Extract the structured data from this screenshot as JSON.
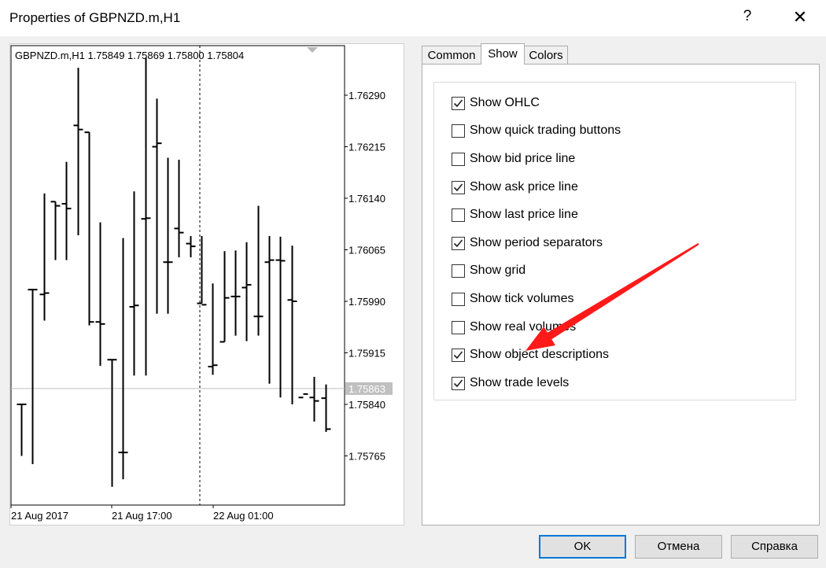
{
  "window": {
    "title": "Properties of GBPNZD.m,H1",
    "help_label": "?",
    "close_label": "✕"
  },
  "chart": {
    "symbol_label": "GBPNZD.m,H1",
    "ohlc_values": "1.75849 1.75869 1.75800 1.75804",
    "price_labels": [
      "1.76290",
      "1.76215",
      "1.76140",
      "1.76065",
      "1.75990",
      "1.75915",
      "1.75840",
      "1.75765"
    ],
    "current_price": "1.75863",
    "time_labels": [
      "21 Aug 2017",
      "21 Aug 17:00",
      "22 Aug 01:00"
    ],
    "bar_color": "#000000",
    "bid_line_color": "#c0c0c0",
    "current_price_bg": "#c0c0c0",
    "bars": [
      {
        "o": 1.7584,
        "h": 1.7584,
        "l": 1.75765,
        "c": 1.7584
      },
      {
        "o": 1.76007,
        "h": 1.76007,
        "l": 1.75753,
        "c": 1.76007
      },
      {
        "o": 1.76,
        "h": 1.76147,
        "l": 1.75962,
        "c": 1.76002
      },
      {
        "o": 1.76135,
        "h": 1.76135,
        "l": 1.7605,
        "c": 1.76129
      },
      {
        "o": 1.76132,
        "h": 1.76193,
        "l": 1.7605,
        "c": 1.76125
      },
      {
        "o": 1.76246,
        "h": 1.7633,
        "l": 1.76086,
        "c": 1.7624
      },
      {
        "o": 1.76236,
        "h": 1.76236,
        "l": 1.75955,
        "c": 1.7596
      },
      {
        "o": 1.7596,
        "h": 1.76105,
        "l": 1.75896,
        "c": 1.75957
      },
      {
        "o": 1.75905,
        "h": 1.75905,
        "l": 1.7572,
        "c": 1.75905
      },
      {
        "o": 1.7577,
        "h": 1.76082,
        "l": 1.75731,
        "c": 1.7577
      },
      {
        "o": 1.75982,
        "h": 1.7615,
        "l": 1.75882,
        "c": 1.75984
      },
      {
        "o": 1.7611,
        "h": 1.76345,
        "l": 1.75882,
        "c": 1.76111
      },
      {
        "o": 1.76215,
        "h": 1.76285,
        "l": 1.75972,
        "c": 1.7622
      },
      {
        "o": 1.76047,
        "h": 1.76199,
        "l": 1.75972,
        "c": 1.76047
      },
      {
        "o": 1.76096,
        "h": 1.76196,
        "l": 1.76054,
        "c": 1.7609
      },
      {
        "o": 1.76074,
        "h": 1.76085,
        "l": 1.76054,
        "c": 1.7607
      },
      {
        "o": 1.75987,
        "h": 1.76085,
        "l": 1.75987,
        "c": 1.75985
      },
      {
        "o": 1.75895,
        "h": 1.76016,
        "l": 1.75883,
        "c": 1.75897
      },
      {
        "o": 1.75931,
        "h": 1.76063,
        "l": 1.75931,
        "c": 1.75995
      },
      {
        "o": 1.75997,
        "h": 1.76064,
        "l": 1.7594,
        "c": 1.75997
      },
      {
        "o": 1.7601,
        "h": 1.76076,
        "l": 1.75932,
        "c": 1.76014
      },
      {
        "o": 1.75968,
        "h": 1.76129,
        "l": 1.7594,
        "c": 1.75968
      },
      {
        "o": 1.76047,
        "h": 1.76085,
        "l": 1.7587,
        "c": 1.7605
      },
      {
        "o": 1.7605,
        "h": 1.76084,
        "l": 1.7585,
        "c": 1.76049
      },
      {
        "o": 1.75992,
        "h": 1.76071,
        "l": 1.7584,
        "c": 1.7599
      },
      {
        "o": 1.7585,
        "h": 1.7585,
        "l": 1.7585,
        "c": 1.75855
      },
      {
        "o": 1.7585,
        "h": 1.7588,
        "l": 1.75815,
        "c": 1.75845
      },
      {
        "o": 1.75849,
        "h": 1.75869,
        "l": 1.758,
        "c": 1.75804
      }
    ]
  },
  "tabs": [
    {
      "label": "Common",
      "active": false
    },
    {
      "label": "Show",
      "active": true
    },
    {
      "label": "Colors",
      "active": false
    }
  ],
  "options": [
    {
      "label": "Show OHLC",
      "checked": true
    },
    {
      "label": "Show quick trading buttons",
      "checked": false
    },
    {
      "label": "Show bid price line",
      "checked": false
    },
    {
      "label": "Show ask price line",
      "checked": true
    },
    {
      "label": "Show last price line",
      "checked": false
    },
    {
      "label": "Show period separators",
      "checked": true
    },
    {
      "label": "Show grid",
      "checked": false
    },
    {
      "label": "Show tick volumes",
      "checked": false
    },
    {
      "label": "Show real volumes",
      "checked": false
    },
    {
      "label": "Show object descriptions",
      "checked": true
    },
    {
      "label": "Show trade levels",
      "checked": true
    }
  ],
  "buttons": {
    "ok": "OK",
    "cancel": "Отмена",
    "help": "Справка"
  },
  "annotation": {
    "arrow_color": "#ff1a1a",
    "arrow_icon": "red-arrow-icon"
  }
}
